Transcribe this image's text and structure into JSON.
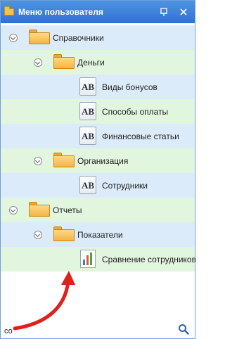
{
  "window": {
    "title": "Меню пользователя",
    "pin_symbol": "⊟",
    "close_symbol": "×"
  },
  "tree": [
    {
      "label": "Справочники",
      "type": "folder",
      "level": 0,
      "expanded": true
    },
    {
      "label": "Деньги",
      "type": "folder",
      "level": 1,
      "expanded": true
    },
    {
      "label": "Виды бонусов",
      "type": "report",
      "level": 2
    },
    {
      "label": "Способы оплаты",
      "type": "report",
      "level": 2
    },
    {
      "label": "Финансовые статьи",
      "type": "report",
      "level": 2
    },
    {
      "label": "Организация",
      "type": "folder",
      "level": 1,
      "expanded": true
    },
    {
      "label": "Сотрудники",
      "type": "report",
      "level": 2
    },
    {
      "label": "Отчеты",
      "type": "folder",
      "level": 0,
      "expanded": true
    },
    {
      "label": "Показатели",
      "type": "folder",
      "level": 1,
      "expanded": true
    },
    {
      "label": "Сравнение сотрудников",
      "type": "chart-report",
      "level": 2
    }
  ],
  "icons": {
    "report_icon_text": "AB"
  },
  "search": {
    "value": "со"
  },
  "colors": {
    "titlebar": "#3a80da",
    "row_blue": "#dcebfa",
    "row_green": "#e2f5df",
    "arrow": "#e0201a"
  }
}
